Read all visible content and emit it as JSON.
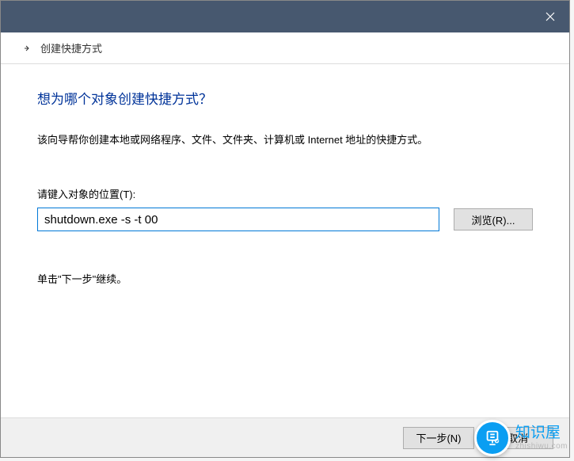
{
  "titlebar": {
    "close_tooltip": "关闭"
  },
  "subtitle": {
    "arrow_name": "back-arrow",
    "text": "创建快捷方式"
  },
  "main": {
    "heading": "想为哪个对象创建快捷方式？",
    "description": "该向导帮你创建本地或网络程序、文件、文件夹、计算机或 Internet 地址的快捷方式。",
    "field_label": "请键入对象的位置(T):",
    "path_value": "shutdown.exe -s -t 00",
    "browse_label": "浏览(R)...",
    "hint": "单击\"下一步\"继续。"
  },
  "footer": {
    "next_label": "下一步(N)",
    "cancel_label": "取消"
  },
  "watermark": {
    "brand": "知识屋",
    "url": "zhishiwu.com"
  }
}
